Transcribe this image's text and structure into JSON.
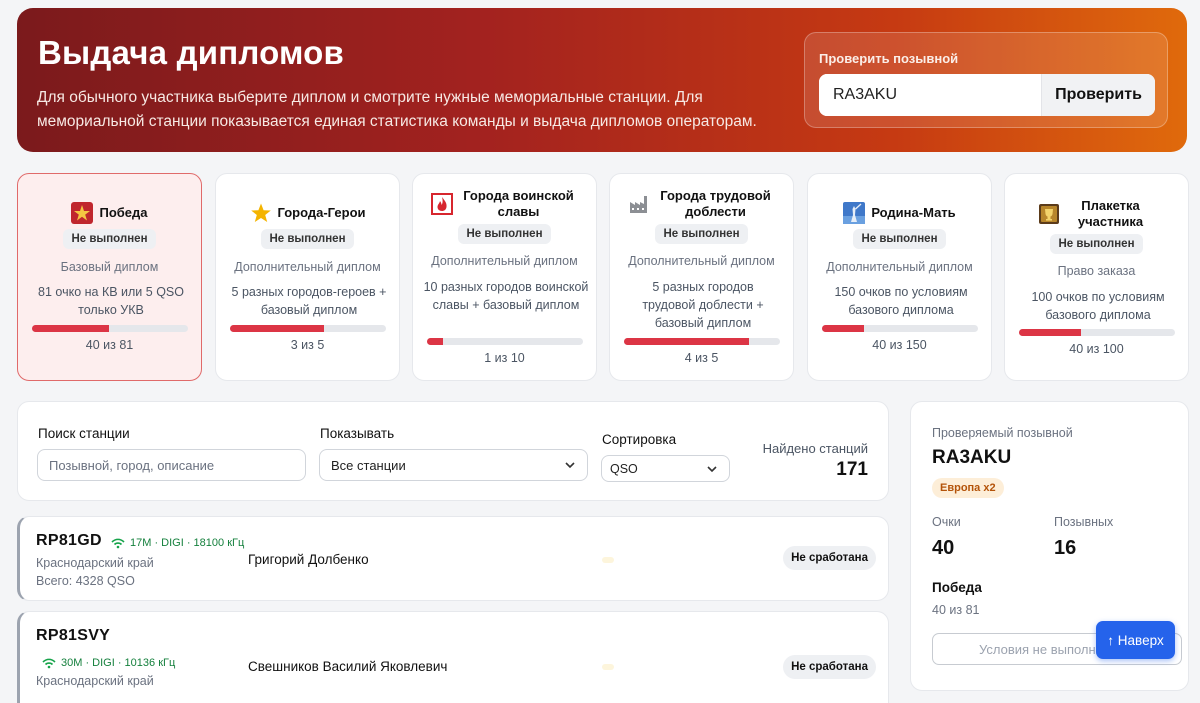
{
  "hero": {
    "title": "Выдача дипломов",
    "description": "Для обычного участника выберите диплом и смотрите нужные мемориальные станции. Для мемориальной станции показывается единая статистика команды и выдача дипломов операторам.",
    "check_label": "Проверить позывной",
    "check_value": "RA3AKU",
    "check_button": "Проверить"
  },
  "diplomas": [
    {
      "title": "Победа",
      "icon": "victory-star-icon",
      "status": "Не выполнен",
      "type": "Базовый диплом",
      "desc": "81 очко на КВ или 5 QSO только УКВ",
      "progress_text": "40 из 81",
      "progress": 0.494,
      "active": true
    },
    {
      "title": "Города-Герои",
      "icon": "gold-star-icon",
      "status": "Не выполнен",
      "type": "Дополнительный диплом",
      "desc": "5 разных городов-героев + базовый диплом",
      "progress_text": "3 из 5",
      "progress": 0.6,
      "active": false
    },
    {
      "title": "Города воинской славы",
      "icon": "flame-icon",
      "status": "Не выполнен",
      "type": "Дополнительный диплом",
      "desc": "10 разных городов воинской славы + базовый диплом",
      "progress_text": "1 из 10",
      "progress": 0.1,
      "active": false
    },
    {
      "title": "Города трудовой доблести",
      "icon": "factory-icon",
      "status": "Не выполнен",
      "type": "Дополнительный диплом",
      "desc": "5 разных городов трудовой доблести + базовый диплом",
      "progress_text": "4 из 5",
      "progress": 0.8,
      "active": false
    },
    {
      "title": "Родина-Мать",
      "icon": "motherland-statue-icon",
      "status": "Не выполнен",
      "type": "Дополнительный диплом",
      "desc": "150 очков по условиям базового диплома",
      "progress_text": "40 из 150",
      "progress": 0.267,
      "active": false
    },
    {
      "title": "Плакетка участника",
      "icon": "plaque-icon",
      "status": "Не выполнен",
      "type": "Право заказа",
      "desc": "100 очков по условиям базового диплома",
      "progress_text": "40 из 100",
      "progress": 0.4,
      "active": false
    }
  ],
  "filters": {
    "search_label": "Поиск станции",
    "search_placeholder": "Позывной, город, описание",
    "show_label": "Показывать",
    "show_value": "Все станции",
    "sort_label": "Сортировка",
    "sort_value": "QSO",
    "found_label": "Найдено станций",
    "found_count": "171"
  },
  "stations": [
    {
      "callsign": "RP81GD",
      "freq": "17M · DIGI · 18100 кГц",
      "region": "Краснодарский край",
      "total": "Всего: 4328 QSO",
      "operator": "Григорий Долбенко",
      "status": "Не сработана"
    },
    {
      "callsign": "RP81SVY",
      "freq": "30M · DIGI · 10136 кГц",
      "region": "Краснодарский край",
      "operator": "Свешников Василий Яковлевич",
      "status": "Не сработана"
    }
  ],
  "side": {
    "label": "Проверяемый позывной",
    "callsign": "RA3AKU",
    "badge": "Европа x2",
    "points_label": "Очки",
    "points": "40",
    "calls_label": "Позывных",
    "calls": "16",
    "diploma": "Победа",
    "diploma_progress": "40 из 81",
    "condition": "Условия не выполнены"
  },
  "up_button": "↑ Наверх",
  "colors": {
    "accent": "#dc3545",
    "primary": "#2563eb",
    "freq": "#15803d"
  }
}
